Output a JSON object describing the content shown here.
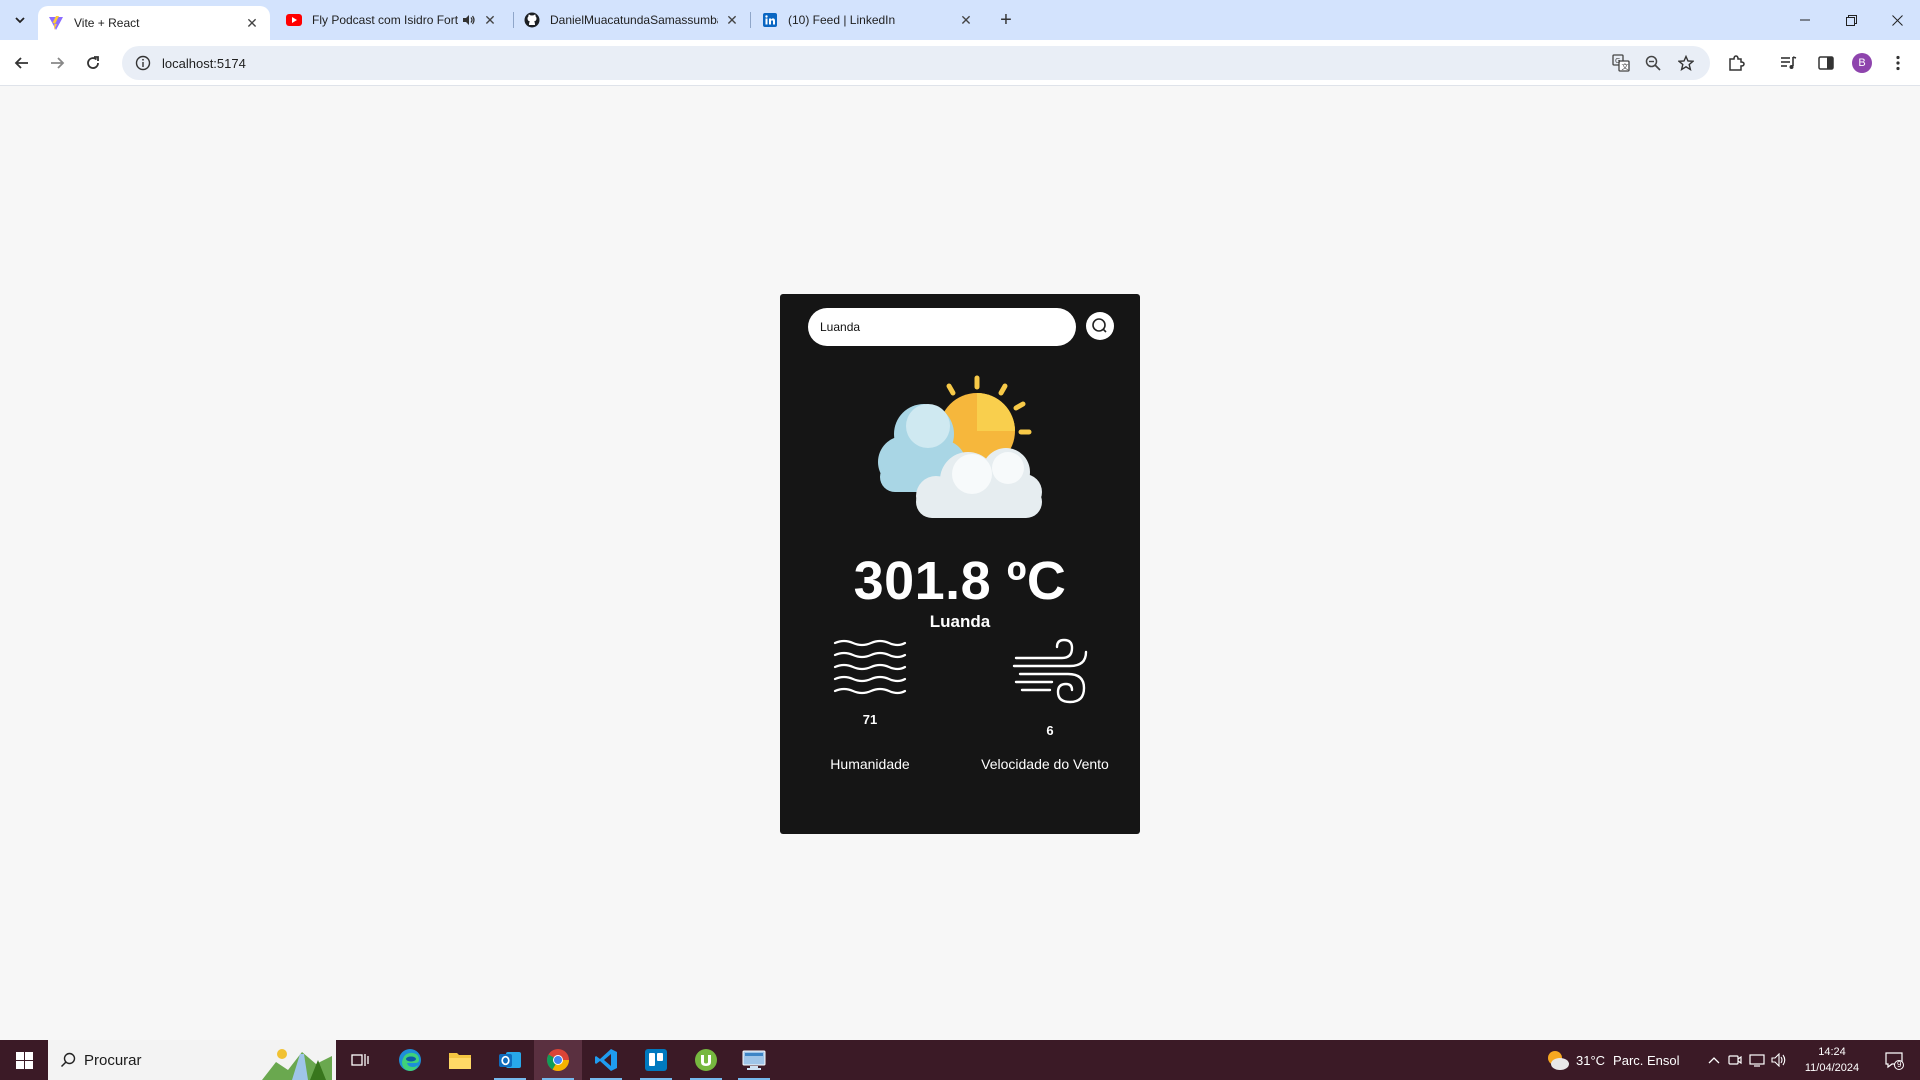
{
  "browser": {
    "tabs": [
      {
        "title": "Vite + React",
        "icon": "vite-icon",
        "active": true
      },
      {
        "title": "Fly Podcast com Isidro Fortu",
        "icon": "youtube-icon",
        "audio": true
      },
      {
        "title": "DanielMuacatundaSamassumba",
        "icon": "github-icon"
      },
      {
        "title": "(10) Feed | LinkedIn",
        "icon": "linkedin-icon"
      }
    ],
    "url": "localhost:5174",
    "profile_initial": "B"
  },
  "weather": {
    "search_value": "Luanda",
    "temperature": "301.8 ºC",
    "city": "Luanda",
    "humidity_value": "71",
    "humidity_label": "Humanidade",
    "wind_value": "6",
    "wind_label": "Velocidade do Vento",
    "condition_icon": "partly-cloudy-icon"
  },
  "taskbar": {
    "search_placeholder": "Procurar",
    "weather_temp": "31°C",
    "weather_text": "Parc. Ensol",
    "time": "14:24",
    "date": "11/04/2024",
    "notifications": "9",
    "apps": [
      "task-view-icon",
      "edge-icon",
      "file-explorer-icon",
      "outlook-icon",
      "chrome-icon",
      "vscode-icon",
      "trello-icon",
      "utorrent-icon",
      "remote-desktop-icon"
    ]
  },
  "colors": {
    "tabstrip": "#d3e3fd",
    "card_bg": "#151515",
    "page_bg": "#f7f7f7",
    "taskbar": "#3b1a26"
  }
}
